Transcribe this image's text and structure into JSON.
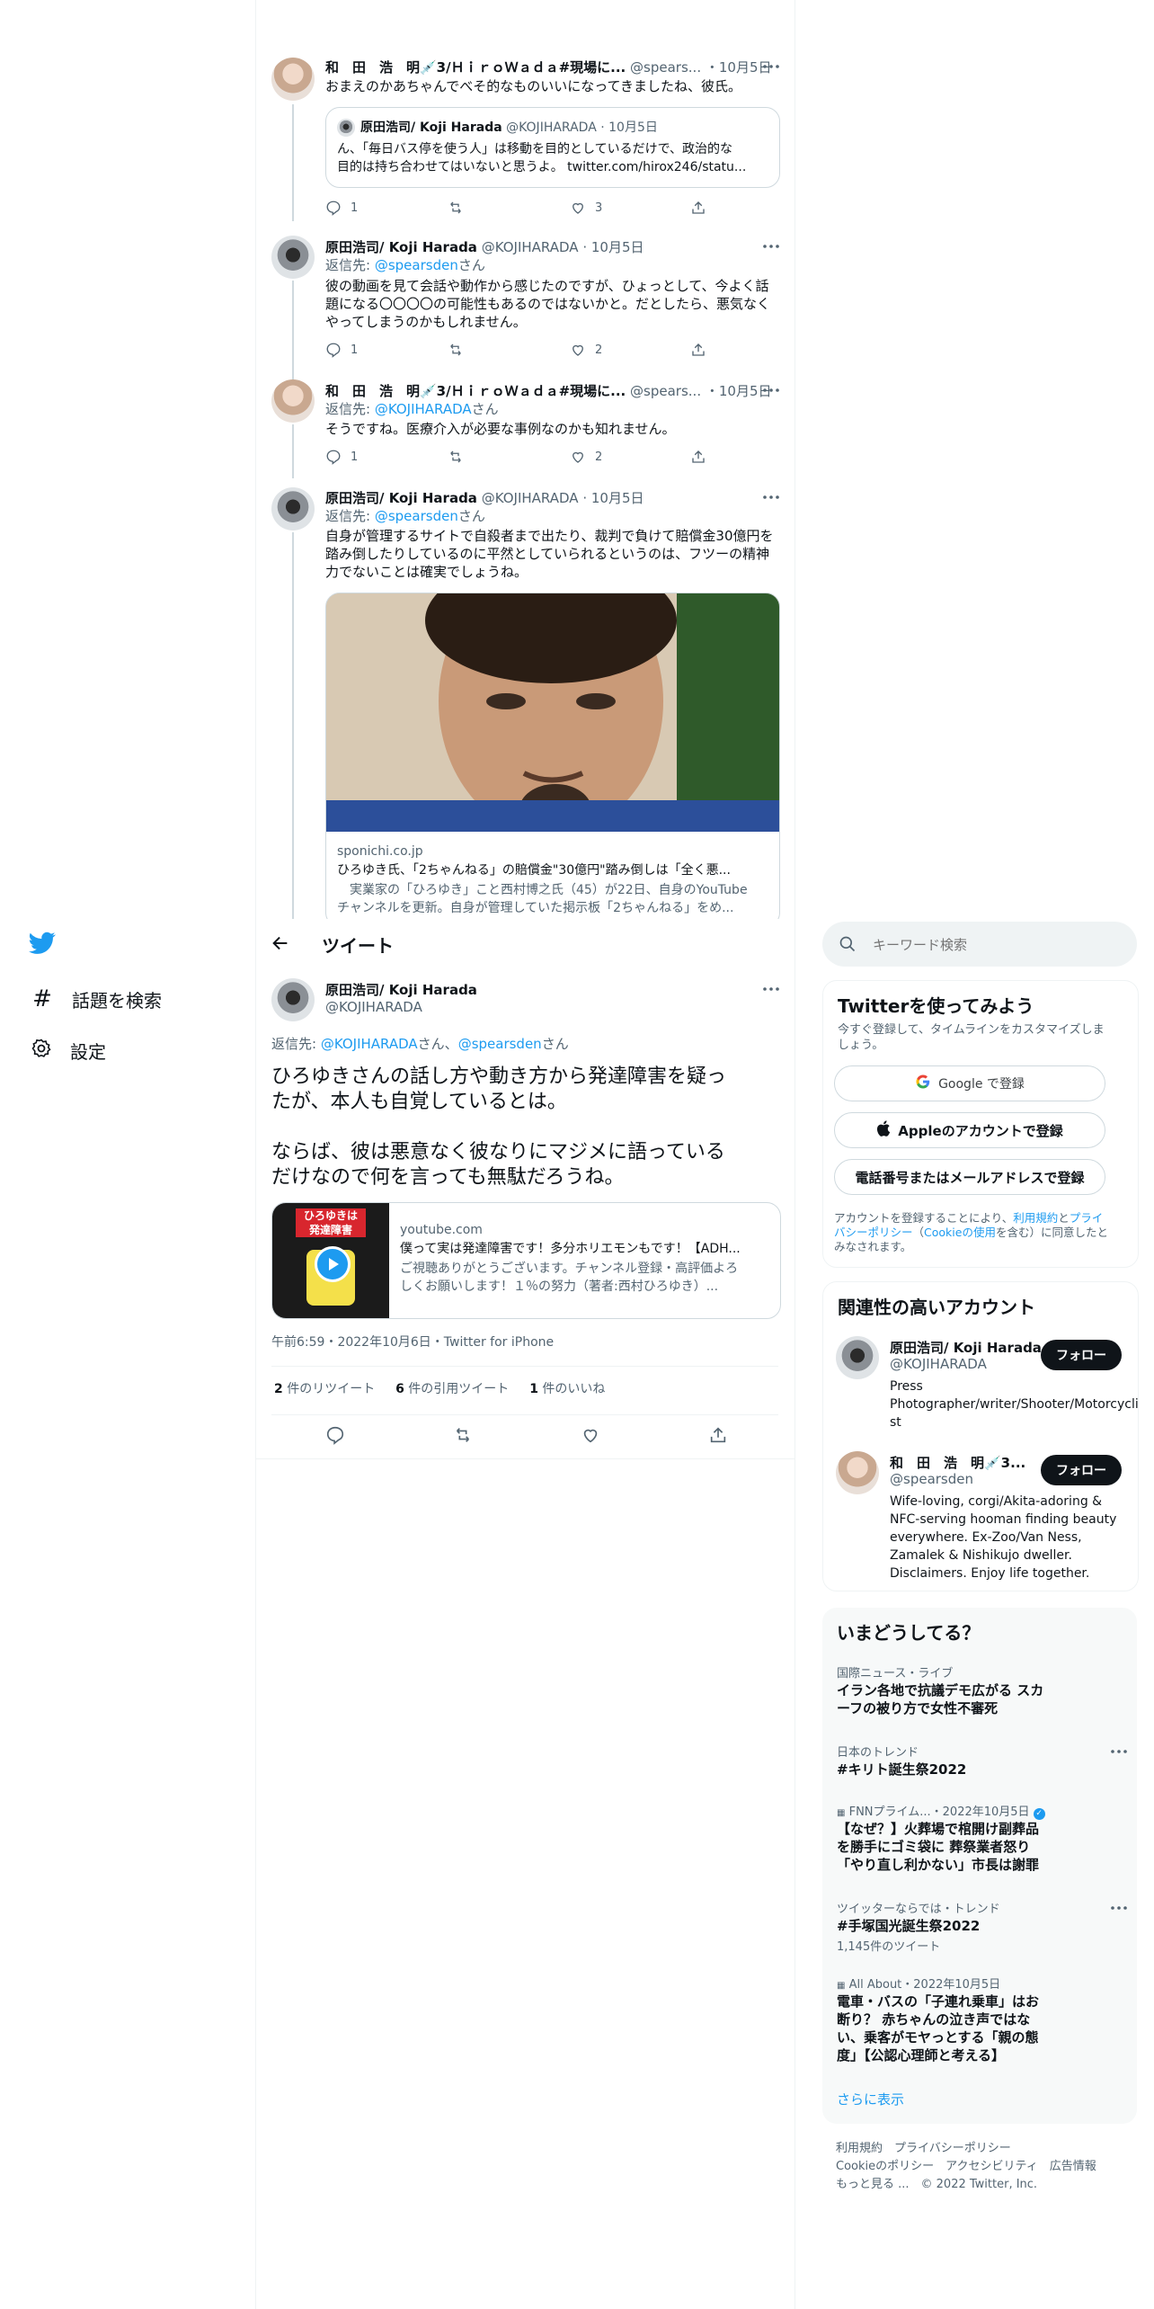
{
  "thread": [
    {
      "author_name": "和　田　浩　明💉3/ＨｉｒｏＷａｄａ#現場に...",
      "handle": "@spears...",
      "time": "・10月5日",
      "text": [
        "おまえのかあちゃんでべそ的なものいいになってきましたね、彼氏。"
      ],
      "quote": {
        "author_name": "原田浩司/ Koji Harada",
        "handle": "@KOJIHARADA",
        "time": "· 10月5日",
        "text": [
          "ん、「毎日バス停を使う人」は移動を目的としているだけで、政治的な",
          "目的は持ち合わせてはいないと思うよ。 twitter.com/hirox246/statu..."
        ]
      },
      "replies": "1",
      "retweets": "",
      "likes": "3"
    },
    {
      "author_name": "原田浩司/ Koji Harada",
      "handle": "@KOJIHARADA",
      "time": "· 10月5日",
      "reply_prefix": "返信先: ",
      "reply_to": "@spearsden",
      "reply_suffix": "さん",
      "text": [
        "彼の動画を見て会話や動作から感じたのですが、ひょっとして、今よく話",
        "題になる〇〇〇〇の可能性もあるのではないかと。だとしたら、悪気なく",
        "やってしまうのかもしれません。"
      ],
      "replies": "1",
      "retweets": "",
      "likes": "2"
    },
    {
      "author_name": "和　田　浩　明💉3/ＨｉｒｏＷａｄａ#現場に...",
      "handle": "@spears...",
      "time": "・10月5日",
      "reply_prefix": "返信先: ",
      "reply_to": "@KOJIHARADA",
      "reply_suffix": "さん",
      "text": [
        "そうですね。医療介入が必要な事例なのかも知れません。"
      ],
      "replies": "1",
      "retweets": "",
      "likes": "2"
    },
    {
      "author_name": "原田浩司/ Koji Harada",
      "handle": "@KOJIHARADA",
      "time": "· 10月5日",
      "reply_prefix": "返信先: ",
      "reply_to": "@spearsden",
      "reply_suffix": "さん",
      "text": [
        "自身が管理するサイトで自殺者まで出たり、裁判で負けて賠償金30億円を",
        "踏み倒したりしているのに平然としていられるというのは、フツーの精神",
        "力でないことは確実でしょうね。"
      ],
      "card": {
        "domain": "sponichi.co.jp",
        "title": "ひろゆき氏、「2ちゃんねる」の賠償金\"30億円\"踏み倒しは「全く悪...",
        "desc": [
          "　実業家の「ひろゆき」こと西村博之氏（45）が22日、自身のYouTube",
          "チャンネルを更新。自身が管理していた掲示板「2ちゃんねる」をめ..."
        ]
      }
    }
  ],
  "sidebar_nav": {
    "explore": "話題を検索",
    "settings": "設定"
  },
  "main": {
    "header_title": "ツイート",
    "author_name": "原田浩司/ Koji Harada",
    "handle": "@KOJIHARADA",
    "reply_prefix": "返信先: ",
    "reply_to_1": "@KOJIHARADA",
    "reply_mid": "さん、",
    "reply_to_2": "@spearsden",
    "reply_suffix": "さん",
    "text": [
      "ひろゆきさんの話し方や動き方から発達障害を疑っ",
      "たが、本人も自覚しているとは。",
      "",
      "ならば、彼は悪意なく彼なりにマジメに語っている",
      "だけなので何を言っても無駄だろうね。"
    ],
    "card": {
      "thumb_text": [
        "ひろゆきは",
        "発達障害"
      ],
      "domain": "youtube.com",
      "title": "僕って実は発達障害です！多分ホリエモンもです！【ADH...",
      "desc": [
        "ご視聴ありがとうございます。チャンネル登録・高評価よろ",
        "しくお願いします！１％の努力（著者:西村ひろゆき）..."
      ]
    },
    "timestamp": "午前6:59・2022年10月6日・Twitter for iPhone",
    "stats": {
      "retweets_count": "2",
      "retweets_label": " 件のリツイート",
      "quotes_count": "6",
      "quotes_label": " 件の引用ツイート",
      "likes_count": "1",
      "likes_label": " 件のいいね"
    }
  },
  "right": {
    "search_placeholder": "キーワード検索",
    "signup": {
      "title": "Twitterを使ってみよう",
      "subtitle": [
        "今すぐ登録して、タイムラインをカスタマイズしま",
        "しょう。"
      ],
      "google_label": "Google で登録",
      "apple_label": "Appleのアカウントで登録",
      "phone_label": "電話番号またはメールアドレスで登録",
      "legal_1": "アカウントを登録することにより、",
      "legal_terms": "利用規約",
      "legal_and": "と",
      "legal_privacy": "プライ",
      "legal_2": "バシーポリシー",
      "legal_3": "（",
      "legal_cookie": "Cookieの使用",
      "legal_4": "を含む）に同意したと",
      "legal_5": "みなされます。"
    },
    "related": {
      "title": "関連性の高いアカウント",
      "accounts": [
        {
          "name": "原田浩司/ Koji Harada",
          "handle": "@KOJIHARADA",
          "bio": [
            "Press",
            "Photographer/writer/Shooter/Motorcycli",
            "st"
          ],
          "follow": "フォロー"
        },
        {
          "name": "和　田　浩　明💉3...",
          "handle": "@spearsden",
          "bio": [
            "Wife-loving, corgi/Akita-adoring &",
            "NFC-serving hooman finding beauty",
            "everywhere. Ex-Zoo/Van Ness,",
            "Zamalek & Nishikujo dweller.",
            "Disclaimers. Enjoy life together."
          ],
          "follow": "フォロー"
        }
      ]
    },
    "trends": {
      "title": "いまどうしてる？",
      "items": [
        {
          "meta": "国際ニュース・ライブ",
          "title": [
            "イラン各地で抗議デモ広がる スカ",
            "ーフの被り方で女性不審死"
          ]
        },
        {
          "meta": "日本のトレンド",
          "title": [
            "#キリト誕生祭2022"
          ]
        },
        {
          "meta": "FNNプライム...・2022年10月5日",
          "title": [
            "【なぜ？】火葬場で棺開け副葬品",
            "を勝手にゴミ袋に 葬祭業者怒り",
            "「やり直し利かない」市長は謝罪"
          ]
        },
        {
          "meta": "ツイッターならでは・トレンド",
          "title": [
            "#手塚国光誕生祭2022"
          ],
          "sub": "1,145件のツイート"
        },
        {
          "meta": "All About・2022年10月5日",
          "title": [
            "電車・バスの「子連れ乗車」はお",
            "断り？ 赤ちゃんの泣き声ではな",
            "い、乗客がモヤっとする「親の態",
            "度」【公認心理師と考える】"
          ]
        }
      ],
      "show_more": "さらに表示"
    },
    "footer": {
      "line1": "利用規約　プライバシーポリシー",
      "line2": "Cookieのポリシー　アクセシビリティ　広告情報",
      "line3": "もっと見る ...　© 2022 Twitter, Inc."
    }
  },
  "colors": {
    "accent": "#1d9bf0",
    "text": "#0f1419",
    "muted": "#536471",
    "border": "#cfd9de"
  }
}
